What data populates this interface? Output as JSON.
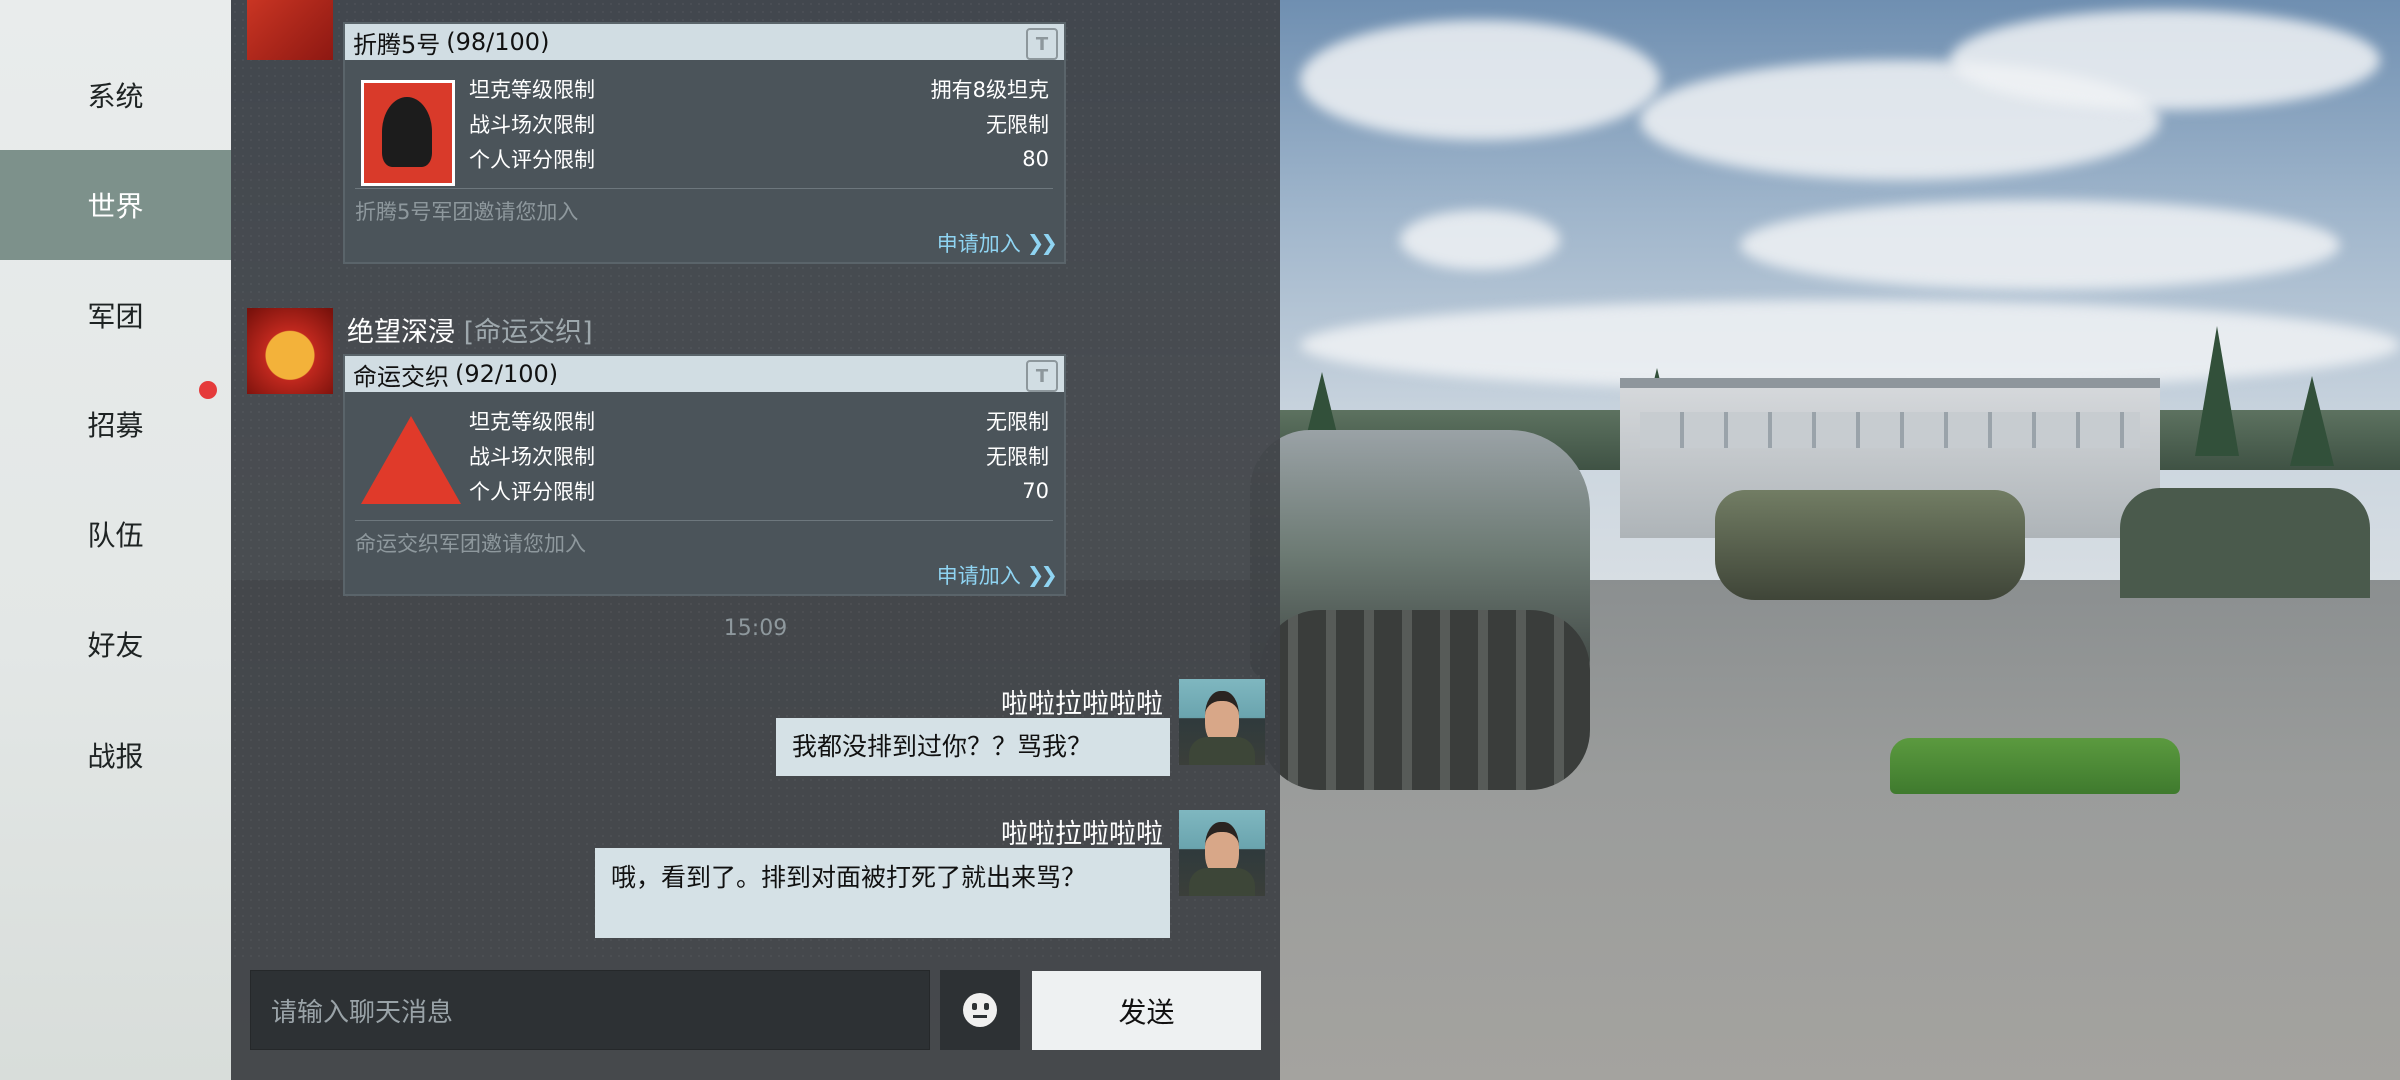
{
  "sidebar": {
    "items": [
      {
        "label": "系统",
        "active": false
      },
      {
        "label": "世界",
        "active": true
      },
      {
        "label": "军团",
        "active": false
      },
      {
        "label": "招募",
        "active": false,
        "notification": true
      },
      {
        "label": "队伍",
        "active": false
      },
      {
        "label": "好友",
        "active": false
      },
      {
        "label": "战报",
        "active": false
      }
    ]
  },
  "messages": {
    "msg1": {
      "card": {
        "name": "折腾5号",
        "capacity": "(98/100)",
        "rows": [
          {
            "label": "坦克等级限制",
            "value": "拥有8级坦克"
          },
          {
            "label": "战斗场次限制",
            "value": "无限制"
          },
          {
            "label": "个人评分限制",
            "value": "80"
          }
        ],
        "invite_text": "折腾5号军团邀请您加入",
        "apply_label": "申请加入",
        "apply_chevrons": "❯❯"
      }
    },
    "msg2": {
      "sender": "绝望深浸",
      "faction": "[命运交织]",
      "card": {
        "name": "命运交织",
        "capacity": "(92/100)",
        "rows": [
          {
            "label": "坦克等级限制",
            "value": "无限制"
          },
          {
            "label": "战斗场次限制",
            "value": "无限制"
          },
          {
            "label": "个人评分限制",
            "value": "70"
          }
        ],
        "invite_text": "命运交织军团邀请您加入",
        "apply_label": "申请加入",
        "apply_chevrons": "❯❯"
      }
    },
    "timestamp": "15:09",
    "msg3": {
      "sender": "啦啦拉啦啦啦",
      "text": "我都没排到过你？？骂我？"
    },
    "msg4": {
      "sender": "啦啦拉啦啦啦",
      "text": "哦，看到了。排到对面被打死了就出来骂？"
    }
  },
  "input": {
    "placeholder": "请输入聊天消息"
  },
  "send_label": "发送",
  "icons": {
    "legion": "legion-tag-icon",
    "emoji": "emoji-icon",
    "apply": "double-chevron-right-icon"
  },
  "colors": {
    "nav_active": "#7d918b",
    "notification": "#e53b3b",
    "apply_link": "#8fd4f2",
    "card_header": "#d1dde3",
    "bubble": "#d5e1e6"
  }
}
